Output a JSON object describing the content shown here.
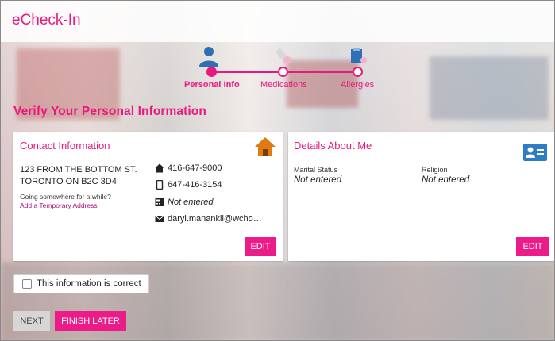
{
  "app": {
    "title": "eCheck-In"
  },
  "stepper": {
    "steps": [
      {
        "label": "Personal Info",
        "icon": "person-icon",
        "state": "active"
      },
      {
        "label": "Medications",
        "icon": "pills-icon",
        "state": "inactive"
      },
      {
        "label": "Allergies",
        "icon": "allergies-icon",
        "state": "inactive"
      }
    ]
  },
  "page": {
    "heading": "Verify Your Personal Information"
  },
  "contact": {
    "title": "Contact Information",
    "icon": "home-icon",
    "address_line1": "123 FROM THE BOTTOM ST.",
    "address_line2": "TORONTO ON B2C 3D4",
    "temp_prompt": "Going somewhere for a while?",
    "temp_link": "Add a Temporary Address",
    "home_phone": "416-647-9000",
    "mobile_phone": "647-416-3154",
    "fax": "Not entered",
    "email": "daryl.manankil@wcho…",
    "edit_label": "EDIT"
  },
  "details": {
    "title": "Details About Me",
    "icon": "id-card-icon",
    "fields": [
      {
        "label": "Marital Status",
        "value": "Not entered"
      },
      {
        "label": "Religion",
        "value": "Not entered"
      }
    ],
    "edit_label": "EDIT"
  },
  "confirm": {
    "label": "This information is correct",
    "checked": false
  },
  "actions": {
    "next_label": "NEXT",
    "finish_label": "FINISH LATER"
  },
  "colors": {
    "accent": "#ec1b87",
    "title_pink": "#e8197e",
    "icon_orange": "#e07a12",
    "icon_blue": "#2f7cc4"
  }
}
